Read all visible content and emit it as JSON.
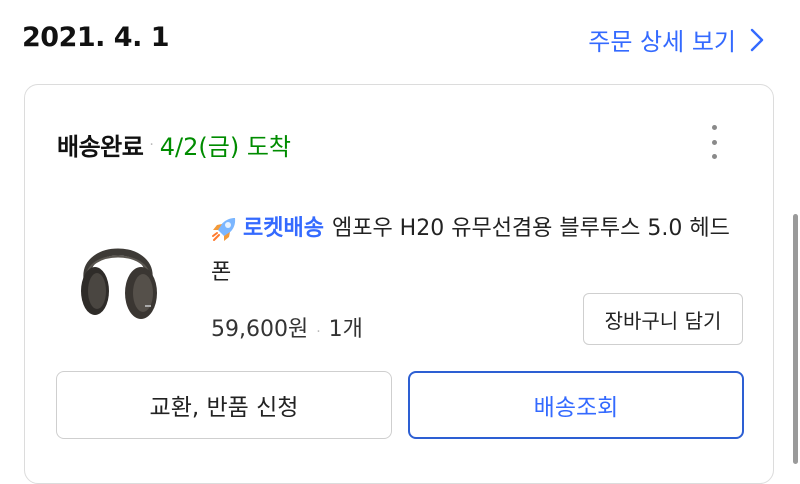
{
  "order": {
    "date": "2021. 4. 1",
    "detail_link": "주문 상세 보기"
  },
  "shipment": {
    "status": "배송완료",
    "arrival": "4/2(금) 도착"
  },
  "product": {
    "badge_text": "로켓배송",
    "name": "엠포우 H20 유무선겸용 블루투스 5.0 헤드폰",
    "price": "59,600원",
    "quantity": "1개"
  },
  "buttons": {
    "add_to_cart": "장바구니 담기",
    "exchange_return": "교환, 반품 신청",
    "track_delivery": "배송조회"
  },
  "icons": {
    "detail_arrow": "chevron-right-icon",
    "more": "kebab-menu-icon",
    "badge": "rocket-icon",
    "thumbnail": "headphones-image"
  },
  "colors": {
    "accent": "#346aff",
    "arrival": "#008c00",
    "border": "#dcdcdc"
  }
}
